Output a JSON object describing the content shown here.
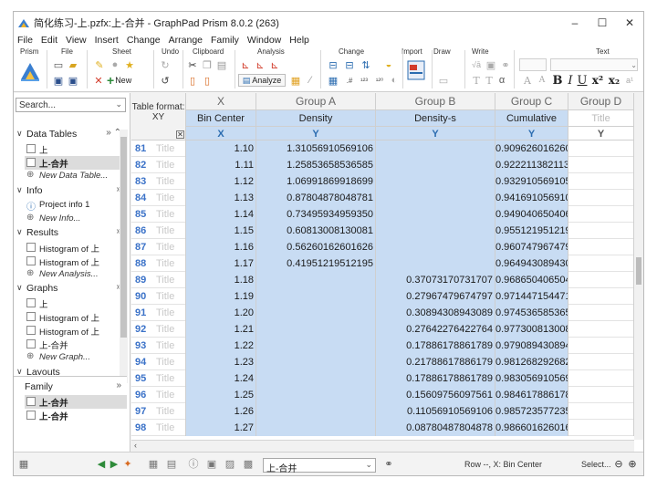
{
  "window": {
    "title": "简化练习-上.pzfx:上-合并 - GraphPad Prism 8.0.2 (263)",
    "controls": {
      "minimize": "–",
      "maximize": "☐",
      "close": "✕"
    }
  },
  "menu": [
    "File",
    "Edit",
    "View",
    "Insert",
    "Change",
    "Arrange",
    "Family",
    "Window",
    "Help"
  ],
  "ribbon": {
    "groups": [
      "Prism",
      "File",
      "Sheet",
      "Undo",
      "Clipboard",
      "Analysis",
      "Change",
      "Import",
      "Draw",
      "Write",
      "Text"
    ],
    "new_label": "New",
    "analyze_label": "Analyze",
    "colors": {
      "accent_red": "#d23b2a",
      "accent_green": "#2e8b3a",
      "accent_blue": "#2b6cb0"
    }
  },
  "navigator": {
    "search_placeholder": "Search...",
    "sections": [
      {
        "label": "Data Tables",
        "items": [
          {
            "label": "上",
            "icon": "data-table-icon"
          },
          {
            "label": "上-合并",
            "icon": "data-table-icon",
            "selected": true
          },
          {
            "label": "New Data Table...",
            "add": true
          }
        ]
      },
      {
        "label": "Info",
        "items": [
          {
            "label": "Project info 1",
            "icon": "info-icon"
          },
          {
            "label": "New Info...",
            "add": true
          }
        ]
      },
      {
        "label": "Results",
        "items": [
          {
            "label": "Histogram of 上",
            "icon": "results-icon"
          },
          {
            "label": "Histogram of 上",
            "icon": "results-icon"
          },
          {
            "label": "New Analysis...",
            "add": true
          }
        ]
      },
      {
        "label": "Graphs",
        "items": [
          {
            "label": "上",
            "icon": "graph-icon"
          },
          {
            "label": "Histogram of 上",
            "icon": "graph-icon"
          },
          {
            "label": "Histogram of 上",
            "icon": "graph-icon"
          },
          {
            "label": "上-合并",
            "icon": "graph-icon"
          },
          {
            "label": "New Graph...",
            "add": true
          }
        ]
      },
      {
        "label": "Layouts",
        "items": []
      }
    ],
    "family": {
      "label": "Family",
      "items": [
        {
          "label": "上-合并",
          "icon": "data-table-icon",
          "selected": true
        },
        {
          "label": "上-合并",
          "icon": "graph-icon"
        }
      ]
    }
  },
  "table": {
    "format_label": "Table format:",
    "format_value": "XY",
    "columns": [
      {
        "group": "X",
        "title": "Bin Center",
        "sub": "X"
      },
      {
        "group": "Group A",
        "title": "Density",
        "sub": "Y"
      },
      {
        "group": "Group B",
        "title": "Density-s",
        "sub": "Y"
      },
      {
        "group": "Group C",
        "title": "Cumulative",
        "sub": "Y"
      },
      {
        "group": "Group D",
        "title": "Title",
        "sub": "Y"
      }
    ],
    "row_title_placeholder": "Title",
    "rows": [
      {
        "num": "81",
        "x": "1.10",
        "a": "1.31056910569106",
        "b": "",
        "c": "0.90962601626016"
      },
      {
        "num": "82",
        "x": "1.11",
        "a": "1.25853658536585",
        "b": "",
        "c": "0.92221138211382"
      },
      {
        "num": "83",
        "x": "1.12",
        "a": "1.06991869918699",
        "b": "",
        "c": "0.93291056910569"
      },
      {
        "num": "84",
        "x": "1.13",
        "a": "0.87804878048781",
        "b": "",
        "c": "0.94169105691057"
      },
      {
        "num": "85",
        "x": "1.14",
        "a": "0.73495934959350",
        "b": "",
        "c": "0.94904065040650"
      },
      {
        "num": "86",
        "x": "1.15",
        "a": "0.60813008130081",
        "b": "",
        "c": "0.95512195121951"
      },
      {
        "num": "87",
        "x": "1.16",
        "a": "0.56260162601626",
        "b": "",
        "c": "0.96074796747968"
      },
      {
        "num": "88",
        "x": "1.17",
        "a": "0.41951219512195",
        "b": "",
        "c": "0.96494308943089"
      },
      {
        "num": "89",
        "x": "1.18",
        "a": "",
        "b": "0.37073170731707",
        "c": "0.96865040650407"
      },
      {
        "num": "90",
        "x": "1.19",
        "a": "",
        "b": "0.27967479674797",
        "c": "0.97144715447155"
      },
      {
        "num": "91",
        "x": "1.20",
        "a": "",
        "b": "0.30894308943089",
        "c": "0.97453658536585"
      },
      {
        "num": "92",
        "x": "1.21",
        "a": "",
        "b": "0.27642276422764",
        "c": "0.97730081300813"
      },
      {
        "num": "93",
        "x": "1.22",
        "a": "",
        "b": "0.17886178861789",
        "c": "0.97908943089431"
      },
      {
        "num": "94",
        "x": "1.23",
        "a": "",
        "b": "0.21788617886179",
        "c": "0.98126829268293"
      },
      {
        "num": "95",
        "x": "1.24",
        "a": "",
        "b": "0.17886178861789",
        "c": "0.98305691056911"
      },
      {
        "num": "96",
        "x": "1.25",
        "a": "",
        "b": "0.15609756097561",
        "c": "0.98461788617886"
      },
      {
        "num": "97",
        "x": "1.26",
        "a": "",
        "b": "0.11056910569106",
        "c": "0.98572357723577"
      },
      {
        "num": "98",
        "x": "1.27",
        "a": "",
        "b": "0.08780487804878",
        "c": "0.98660162601626"
      }
    ]
  },
  "statusbar": {
    "sheet_value": "上-合并",
    "status_text": "Row --, X: Bin Center",
    "select_label": "Select..."
  }
}
